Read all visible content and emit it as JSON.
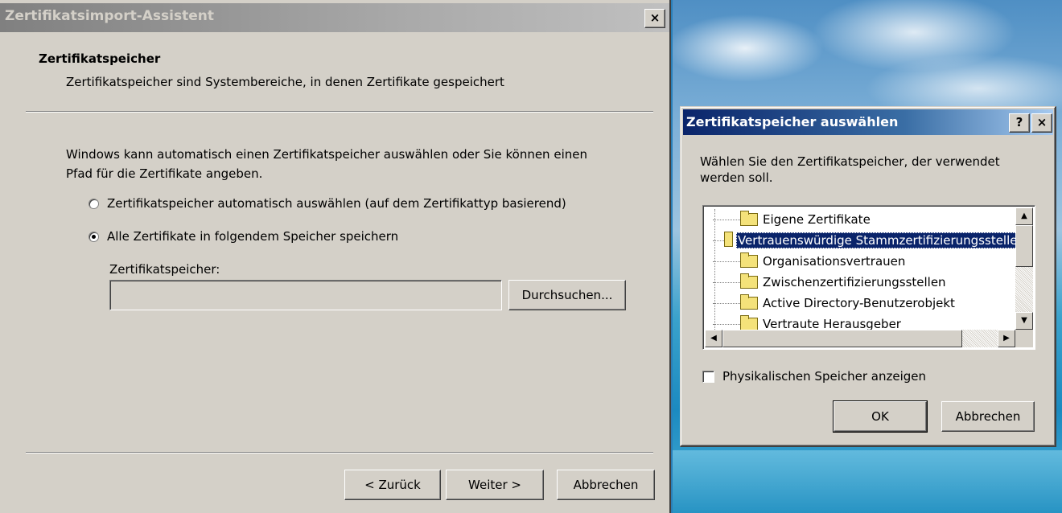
{
  "wizard": {
    "title": "Zertifikatsimport-Assistent",
    "close_label": "×",
    "header_title": "Zertifikatspeicher",
    "header_subtitle": "Zertifikatspeicher sind Systembereiche, in denen Zertifikate gespeichert",
    "body_line1": "Windows kann automatisch einen Zertifikatspeicher auswählen oder Sie können einen",
    "body_line2": "Pfad für die Zertifikate angeben.",
    "radio_auto_label": "Zertifikatspeicher automatisch auswählen (auf dem Zertifikattyp basierend)",
    "radio_manual_label": "Alle Zertifikate in folgendem Speicher speichern",
    "selected_radio": "manual",
    "store_label": "Zertifikatspeicher:",
    "store_value": "",
    "browse_label": "Durchsuchen...",
    "back_label": "< Zurück",
    "next_label": "Weiter >",
    "cancel_label": "Abbrechen"
  },
  "dialog": {
    "title": "Zertifikatspeicher auswählen",
    "help_label": "?",
    "close_label": "×",
    "prompt_line1": "Wählen Sie den Zertifikatspeicher, der verwendet",
    "prompt_line2": "werden soll.",
    "stores": [
      {
        "label": "Eigene Zertifikate",
        "selected": false
      },
      {
        "label": "Vertrauenswürdige Stammzertifizierungsstellen",
        "selected": true
      },
      {
        "label": "Organisationsvertrauen",
        "selected": false
      },
      {
        "label": "Zwischenzertifizierungsstellen",
        "selected": false
      },
      {
        "label": "Active Directory-Benutzerobjekt",
        "selected": false
      },
      {
        "label": "Vertraute Herausgeber",
        "selected": false
      }
    ],
    "show_physical_label": "Physikalischen Speicher anzeigen",
    "show_physical_checked": false,
    "ok_label": "OK",
    "cancel_label": "Abbrechen"
  },
  "colors": {
    "window_face": "#d4d0c8",
    "active_title_start": "#0a246a",
    "active_title_end": "#a6caf0",
    "inactive_title": "#808080",
    "selection": "#0a246a"
  },
  "icons": [
    "folder-icon",
    "radio-icon",
    "checkbox-icon",
    "scroll-up-icon",
    "scroll-down-icon",
    "scroll-left-icon",
    "scroll-right-icon"
  ]
}
